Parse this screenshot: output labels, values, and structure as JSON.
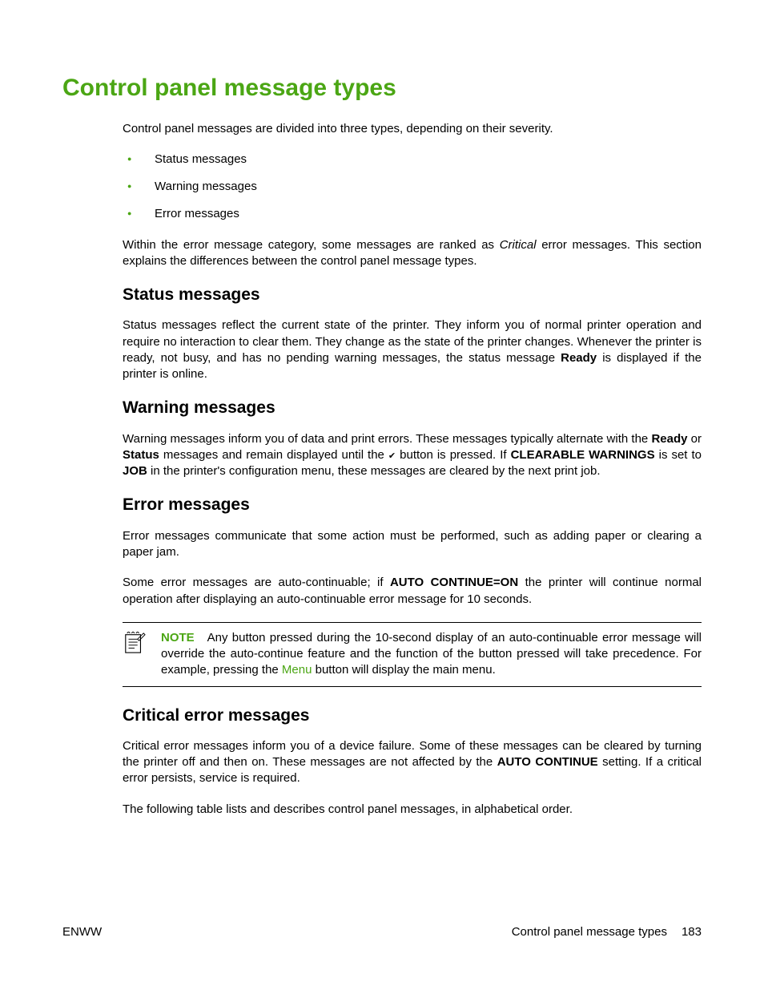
{
  "title": "Control panel message types",
  "intro": "Control panel messages are divided into three types, depending on their severity.",
  "bullets": [
    "Status messages",
    "Warning messages",
    "Error messages"
  ],
  "intro2_part1": "Within the error message category, some messages are ranked as ",
  "intro2_critical": "Critical",
  "intro2_part2": " error messages. This section explains the differences between the control panel message types.",
  "status": {
    "heading": "Status messages",
    "p1_part1": "Status messages reflect the current state of the printer. They inform you of normal printer operation and require no interaction to clear them. They change as the state of the printer changes. Whenever the printer is ready, not busy, and has no pending warning messages, the status message ",
    "p1_ready": "Ready",
    "p1_part2": " is displayed if the printer is online."
  },
  "warning": {
    "heading": "Warning messages",
    "p1_part1": "Warning messages inform you of data and print errors. These messages typically alternate with the ",
    "p1_ready": "Ready",
    "p1_or": " or ",
    "p1_status": "Status",
    "p1_part2": " messages and remain displayed until the ",
    "p1_part3": " button is pressed. If ",
    "p1_clearable": "CLEARABLE WARNINGS",
    "p1_part4": " is set to ",
    "p1_job": "JOB",
    "p1_part5": " in the printer's configuration menu, these messages are cleared by the next print job."
  },
  "error": {
    "heading": "Error messages",
    "p1": "Error messages communicate that some action must be performed, such as adding paper or clearing a paper jam.",
    "p2_part1": "Some error messages are auto-continuable; if ",
    "p2_auto": "AUTO CONTINUE=ON",
    "p2_part2": " the printer will continue normal operation after displaying an auto-continuable error message for 10 seconds."
  },
  "note": {
    "label": "NOTE",
    "text_part1": "Any button pressed during the 10-second display of an auto-continuable error message will override the auto-continue feature and the function of the button pressed will take precedence. For example, pressing the ",
    "menu": "Menu",
    "text_part2": " button will display the main menu."
  },
  "critical": {
    "heading": "Critical error messages",
    "p1_part1": "Critical error messages inform you of a device failure. Some of these messages can be cleared by turning the printer off and then on. These messages are not affected by the ",
    "p1_auto": "AUTO CONTINUE",
    "p1_part2": " setting. If a critical error persists, service is required.",
    "p2": "The following table lists and describes control panel messages, in alphabetical order."
  },
  "footer": {
    "left": "ENWW",
    "right_text": "Control panel message types",
    "page": "183"
  }
}
